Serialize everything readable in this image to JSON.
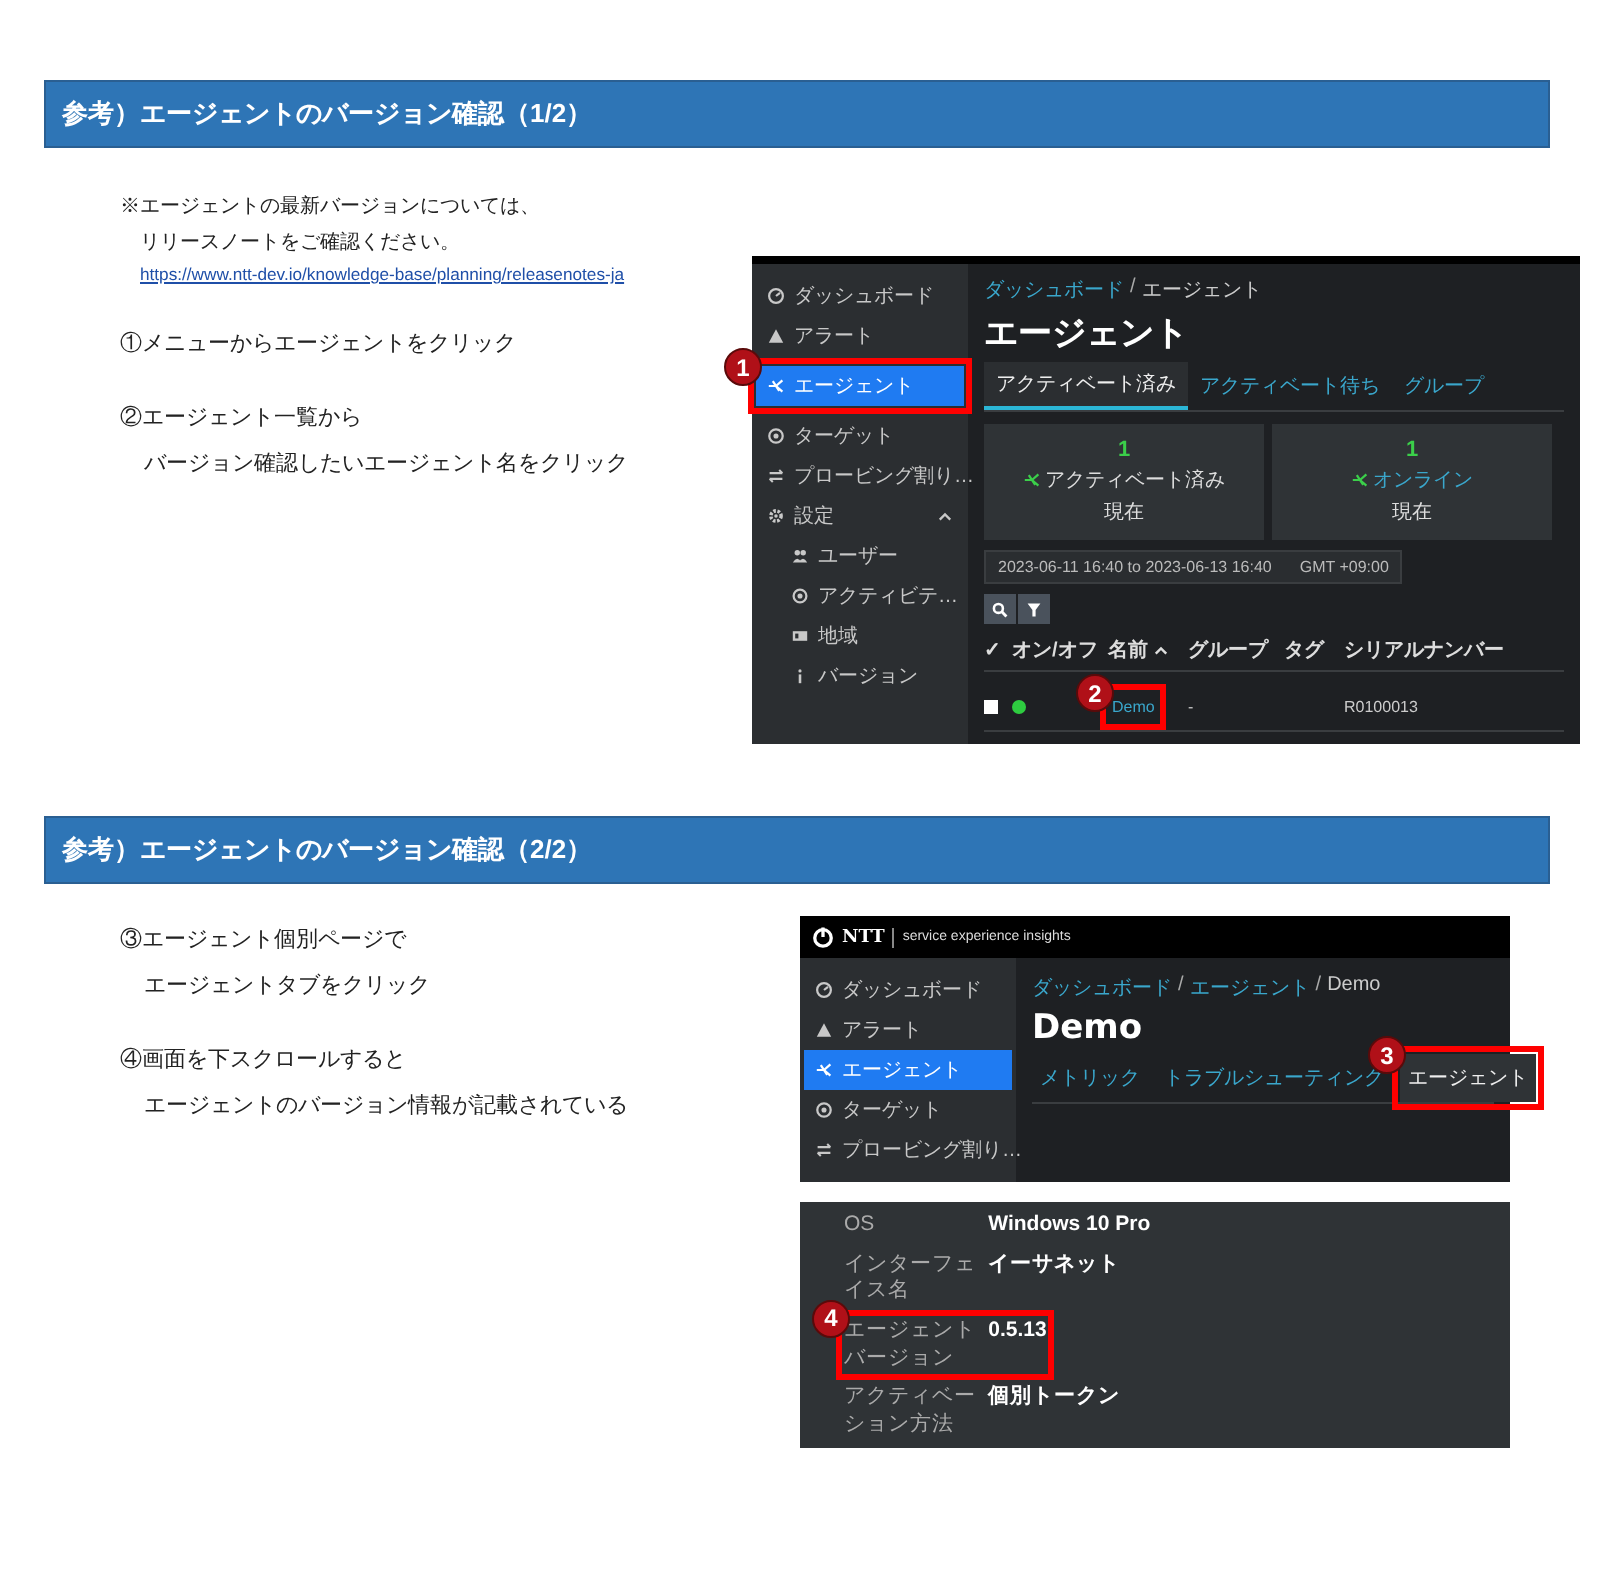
{
  "section_1": {
    "title": "参考）エージェントのバージョン確認（1/2）",
    "note_lines": [
      "※エージェントの最新バージョンについては、",
      "リリースノートをご確認ください。"
    ],
    "note_link": "https://www.ntt-dev.io/knowledge-base/planning/releasenotes-ja",
    "steps": [
      {
        "lines": [
          "①メニューからエージェントをクリック"
        ]
      },
      {
        "lines": [
          "②エージェント一覧から",
          "バージョン確認したいエージェント名をクリック"
        ]
      }
    ],
    "screenshot": {
      "sidebar": {
        "items": [
          {
            "label": "ダッシュボード",
            "selected": false
          },
          {
            "label": "アラート",
            "selected": false
          },
          {
            "label": "エージェント",
            "selected": true,
            "callout": "1"
          },
          {
            "label": "ターゲット",
            "selected": false
          },
          {
            "label": "プロービング割り…",
            "selected": false
          },
          {
            "label": "設定",
            "selected": false,
            "expanded": true,
            "children": [
              {
                "label": "ユーザー",
                "selected": false
              },
              {
                "label": "アクティビテ…",
                "selected": false
              },
              {
                "label": "地域",
                "selected": false
              },
              {
                "label": "バージョン",
                "selected": false
              }
            ]
          }
        ]
      },
      "breadcrumb": {
        "items": [
          "ダッシュボード",
          "エージェント"
        ],
        "separator": "/"
      },
      "title": "エージェント",
      "tabs": [
        {
          "label": "アクティベート済み",
          "selected": true
        },
        {
          "label": "アクティベート待ち",
          "selected": false
        },
        {
          "label": "グループ",
          "selected": false
        }
      ],
      "cards": [
        {
          "value": "1",
          "label": "アクティベート済み",
          "link": false,
          "sub": "現在"
        },
        {
          "value": "1",
          "label": "オンライン",
          "link": true,
          "sub": "現在"
        }
      ],
      "date_range": "2023-06-11 16:40 to 2023-06-13 16:40",
      "timezone": "GMT +09:00",
      "table": {
        "columns": [
          {
            "label": "✓",
            "sorted": false
          },
          {
            "label": "オン/オフ",
            "sorted": false
          },
          {
            "label": "名前",
            "sorted": true
          },
          {
            "label": "グループ",
            "sorted": false
          },
          {
            "label": "タグ",
            "sorted": false
          },
          {
            "label": "シリアルナンバー",
            "sorted": false
          }
        ],
        "rows": [
          {
            "checked": false,
            "online": true,
            "name": "Demo",
            "callout": "2",
            "group": "-",
            "serial": "R0100013"
          }
        ]
      }
    }
  },
  "section_2": {
    "title": "参考）エージェントのバージョン確認（2/2）",
    "steps": [
      {
        "lines": [
          "③エージェント個別ページで",
          "エージェントタブをクリック"
        ]
      },
      {
        "lines": [
          "④画面を下スクロールすると",
          "エージェントのバージョン情報が記載されている"
        ]
      }
    ],
    "screenshot_top": {
      "brand": "NTT",
      "product": "service experience insights",
      "sidebar": {
        "items": [
          {
            "label": "ダッシュボード",
            "selected": false
          },
          {
            "label": "アラート",
            "selected": false
          },
          {
            "label": "エージェント",
            "selected": true
          },
          {
            "label": "ターゲット",
            "selected": false
          },
          {
            "label": "プロービング割り…",
            "selected": false
          }
        ]
      },
      "breadcrumb": {
        "items": [
          "ダッシュボード",
          "エージェント",
          "Demo"
        ],
        "separator": "/"
      },
      "title": "Demo",
      "tabs": [
        {
          "label": "メトリック",
          "selected": false
        },
        {
          "label": "トラブルシューティング",
          "selected": false
        },
        {
          "label": "エージェント",
          "selected": true,
          "callout": "3"
        }
      ]
    },
    "screenshot_details": {
      "rows": [
        {
          "label": "OS",
          "value": "Windows 10 Pro"
        },
        {
          "label": "インターフェイス名",
          "value": "イーサネット"
        },
        {
          "label": "エージェントバージョン",
          "value": "0.5.13",
          "callout": "4"
        },
        {
          "label": "アクティベーション方法",
          "value": "個別トークン"
        }
      ]
    }
  }
}
